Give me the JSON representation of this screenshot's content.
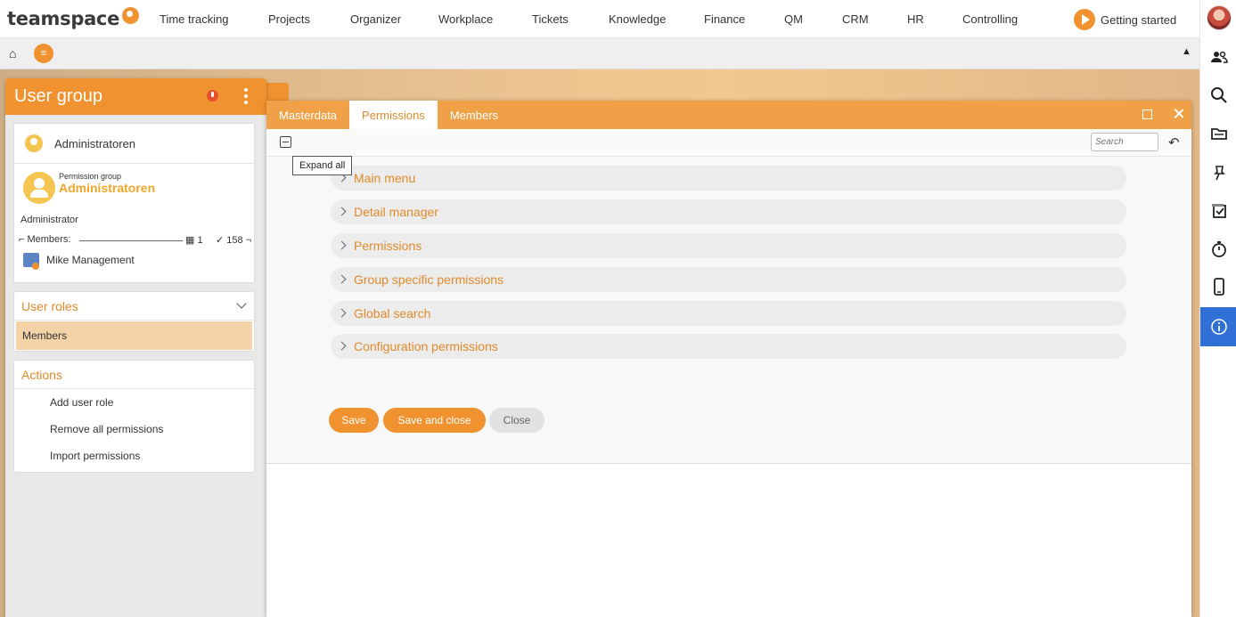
{
  "app": {
    "brand": "teamspace",
    "accent_color": "#f0922f"
  },
  "topnav": {
    "items": [
      "Time tracking",
      "Projects",
      "Organizer",
      "Workplace",
      "Tickets",
      "Knowledge",
      "Finance",
      "QM",
      "CRM",
      "HR",
      "Controlling"
    ],
    "getting_started": "Getting started"
  },
  "right_rail": {
    "icons": [
      "people-icon",
      "search-icon",
      "folder-icon",
      "pin-icon",
      "tasks-check-icon",
      "stopwatch-icon",
      "mobile-icon",
      "info-icon"
    ],
    "active": "info-icon"
  },
  "subbar": {
    "home_icon": "⌂",
    "menu_icon": "≡",
    "collapse_icon": "▲"
  },
  "left_panel": {
    "title": "User group",
    "info": {
      "group_name": "Administratoren",
      "permission_group_label": "Permission group",
      "permission_group_name": "Administratoren",
      "role": "Administrator",
      "members_label": "Members:",
      "members_count_org": "1",
      "members_count_check": "158",
      "member": "Mike Management"
    },
    "user_roles": {
      "title": "User roles",
      "items": [
        "Members"
      ]
    },
    "actions": {
      "title": "Actions",
      "items": [
        "Add user role",
        "Remove all permissions",
        "Import permissions"
      ]
    }
  },
  "dialog": {
    "tabs": [
      "Masterdata",
      "Permissions",
      "Members"
    ],
    "active_tab": "Permissions",
    "search_placeholder": "Search",
    "tooltip": "Expand all",
    "sections": [
      "Main menu",
      "Detail manager",
      "Permissions",
      "Group specific permissions",
      "Global search",
      "Configuration permissions"
    ],
    "buttons": {
      "save": "Save",
      "save_close": "Save and close",
      "close": "Close"
    }
  }
}
